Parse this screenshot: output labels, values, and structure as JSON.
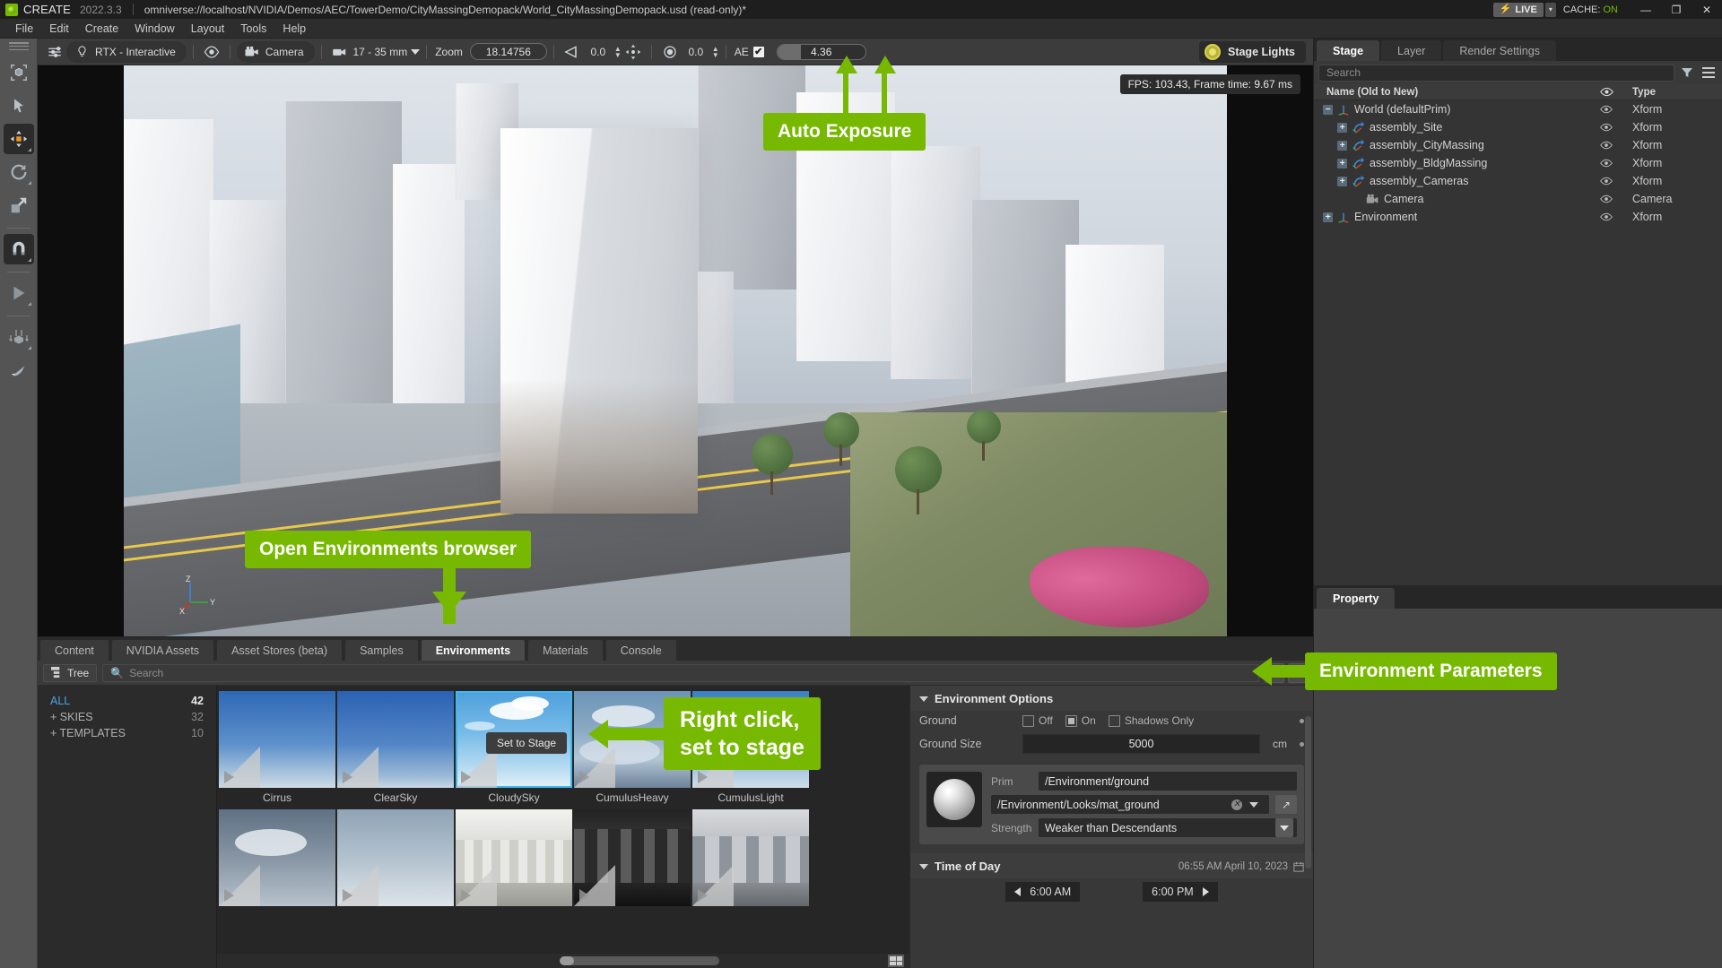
{
  "titlebar": {
    "app": "CREATE",
    "version": "2022.3.3",
    "path": "omniverse://localhost/NVIDIA/Demos/AEC/TowerDemo/CityMassingDemopack/World_CityMassingDemopack.usd (read-only)*",
    "live_label": "LIVE",
    "live_dropdown": "▾",
    "cache_label": "CACHE:",
    "cache_value": "ON",
    "minimize": "—",
    "maximize": "❐",
    "close": "✕"
  },
  "menubar": {
    "items": [
      "File",
      "Edit",
      "Create",
      "Window",
      "Layout",
      "Tools",
      "Help"
    ]
  },
  "left_toolbar": {
    "tools": [
      {
        "name": "select-bounding-box-tool",
        "glyph": "box"
      },
      {
        "name": "selection-arrow-tool",
        "glyph": "arrow"
      },
      {
        "name": "move-tool",
        "glyph": "move",
        "active": true
      },
      {
        "name": "rotate-tool",
        "glyph": "rotate"
      },
      {
        "name": "scale-tool",
        "glyph": "scale"
      },
      {
        "name": "snap-magnet-tool",
        "glyph": "magnet",
        "active": true
      },
      {
        "name": "play-tool",
        "glyph": "play"
      },
      {
        "name": "physics-drop-tool",
        "glyph": "drop"
      },
      {
        "name": "paint-tool",
        "glyph": "brush"
      }
    ]
  },
  "viewport_toolbar": {
    "renderer": "RTX - Interactive",
    "camera": "Camera",
    "lens": "17 - 35 mm",
    "zoom_label": "Zoom",
    "zoom_value": "18.14756",
    "speed_value": "0.0",
    "aperture_value": "0.0",
    "ae_label": "AE",
    "ae_checked": "✔",
    "exposure_value": "4.36",
    "stage_lights": "Stage Lights"
  },
  "viewport": {
    "fps_text": "FPS: 103.43, Frame time: 9.67 ms",
    "axis": {
      "x": "X",
      "y": "Y",
      "z": "Z"
    }
  },
  "callouts": [
    {
      "id": "auto-exposure",
      "text": "Auto Exposure"
    },
    {
      "id": "open-environments-browser",
      "text": "Open Environments browser"
    },
    {
      "id": "right-click-set-to-stage",
      "text": "Right click,\nset to stage"
    },
    {
      "id": "environment-parameters",
      "text": "Environment Parameters"
    }
  ],
  "bottom_panel": {
    "tabs": [
      {
        "label": "Content",
        "active": false
      },
      {
        "label": "NVIDIA Assets",
        "active": false
      },
      {
        "label": "Asset Stores (beta)",
        "active": false
      },
      {
        "label": "Samples",
        "active": false
      },
      {
        "label": "Environments",
        "active": true
      },
      {
        "label": "Materials",
        "active": false
      },
      {
        "label": "Console",
        "active": false
      }
    ],
    "tree_button": "Tree",
    "search_placeholder": "Search",
    "settings_icon": "gear-icon",
    "list_icon": "list-icon",
    "categories": [
      {
        "label": "ALL",
        "count": "42",
        "selected": true
      },
      {
        "label": "+ SKIES",
        "count": "32",
        "selected": false
      },
      {
        "label": "+ TEMPLATES",
        "count": "10",
        "selected": false
      }
    ],
    "context_menu": {
      "label": "Set to Stage"
    },
    "thumbnails_row1": [
      {
        "label": "Cirrus",
        "selected": false,
        "sky": "cirrus"
      },
      {
        "label": "ClearSky",
        "selected": false,
        "sky": "clear"
      },
      {
        "label": "CloudySky",
        "selected": true,
        "sky": "cloudy"
      },
      {
        "label": "CumulusHeavy",
        "selected": false,
        "sky": "cumulus-heavy"
      },
      {
        "label": "CumulusLight",
        "selected": false,
        "sky": "cumulus-light"
      }
    ],
    "thumbnails_row2": [
      {
        "label": "",
        "selected": false,
        "sky": "overcast"
      },
      {
        "label": "",
        "selected": false,
        "sky": "hazy"
      },
      {
        "label": "",
        "selected": false,
        "sky": "studio-a"
      },
      {
        "label": "",
        "selected": false,
        "sky": "studio-b"
      },
      {
        "label": "",
        "selected": false,
        "sky": "studio-c"
      }
    ]
  },
  "environment_panel": {
    "options_title": "Environment Options",
    "ground_label": "Ground",
    "ground_off": "Off",
    "ground_on": "On",
    "ground_shadows_only": "Shadows Only",
    "ground_size_label": "Ground Size",
    "ground_size_value": "5000",
    "ground_size_unit": "cm",
    "prim_label": "Prim",
    "prim_value": "/Environment/ground",
    "material_value": "/Environment/Looks/mat_ground",
    "strength_label": "Strength",
    "strength_value": "Weaker than Descendants",
    "time_of_day_title": "Time of Day",
    "time_of_day_value": "06:55 AM  April 10, 2023",
    "sunrise": "6:00  AM",
    "sunset": "6:00  PM"
  },
  "right_panel": {
    "tabs": [
      {
        "label": "Stage",
        "active": true
      },
      {
        "label": "Layer",
        "active": false
      },
      {
        "label": "Render Settings",
        "active": false
      }
    ],
    "search_placeholder": "Search",
    "filter_icon": "filter-icon",
    "options_icon": "hamburger-icon",
    "columns": {
      "name": "Name (Old to New)",
      "visibility": "eye-icon",
      "type": "Type"
    },
    "rows": [
      {
        "label": "World (defaultPrim)",
        "type": "Xform",
        "indent": 0,
        "expander": "−",
        "icon": "xform-axis-icon"
      },
      {
        "label": "assembly_Site",
        "type": "Xform",
        "indent": 1,
        "expander": "+",
        "icon": "reference-xform-icon"
      },
      {
        "label": "assembly_CityMassing",
        "type": "Xform",
        "indent": 1,
        "expander": "+",
        "icon": "reference-xform-icon"
      },
      {
        "label": "assembly_BldgMassing",
        "type": "Xform",
        "indent": 1,
        "expander": "+",
        "icon": "reference-xform-icon"
      },
      {
        "label": "assembly_Cameras",
        "type": "Xform",
        "indent": 1,
        "expander": "+",
        "icon": "reference-xform-icon"
      },
      {
        "label": "Camera",
        "type": "Camera",
        "indent": 2,
        "expander": "",
        "icon": "camera-icon"
      },
      {
        "label": "Environment",
        "type": "Xform",
        "indent": 0,
        "expander": "+",
        "icon": "xform-axis-icon"
      }
    ],
    "property_tab": "Property"
  },
  "colors": {
    "accent_green": "#76b900",
    "selection_blue": "#3fb8ef",
    "link_blue": "#4aa3e0",
    "panel_bg": "#333333",
    "toolbar_bg": "#3c3c3c"
  }
}
